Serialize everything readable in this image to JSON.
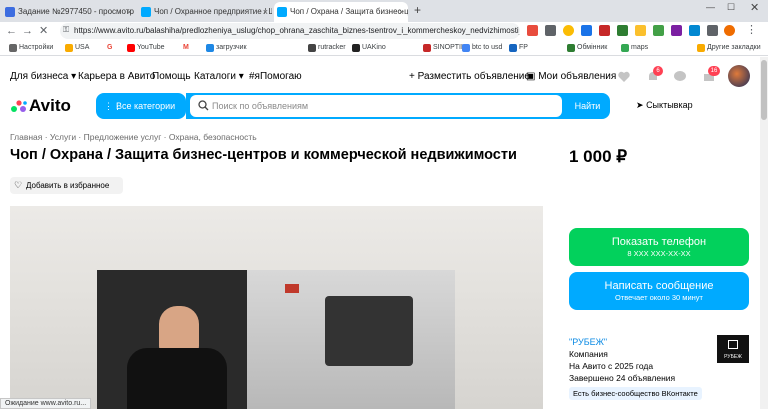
{
  "browser": {
    "tabs": [
      {
        "label": "Задание №2977450 - просмотр з",
        "favicon": "sp-icon",
        "color": "#3d6de0"
      },
      {
        "label": "Чоп / Охранное предприятие / Ш",
        "favicon": "avito-icon",
        "color": "#00aaff"
      },
      {
        "label": "Чоп / Охрана / Защита бизнес-ц",
        "favicon": "avito-icon",
        "color": "#00aaff"
      }
    ],
    "url": "https://www.avito.ru/balashiha/predlozheniya_uslug/chop_ohrana_zaschita_biznes-tsentrov_i_kommercheskoy_nedvizhimosti_...",
    "bookmarks": [
      "Настройки",
      "USA",
      "G",
      "YouTube",
      "M",
      "загрузчик",
      "rutracker",
      "UAKino",
      "SINOPTIK",
      "btc to usd",
      "FP",
      "Обмінник",
      "maps",
      "Другие закладки"
    ],
    "status": "Ожидание www.avito.ru..."
  },
  "header": {
    "links": [
      "Для бизнеса",
      "Карьера в Авито",
      "Помощь",
      "Каталоги",
      "#яПомогаю"
    ],
    "post_ad": "Разместить объявление",
    "my_ads": "Мои объявления",
    "notif_count": "6",
    "cart_count": "16"
  },
  "search": {
    "logo": "Avito",
    "categories_label": "Все категории",
    "placeholder": "Поиск по объявлениям",
    "button": "Найти",
    "location": "Сыктывкар"
  },
  "listing": {
    "breadcrumb": [
      "Главная",
      "Услуги",
      "Предложение услуг",
      "Охрана, безопасность"
    ],
    "title": "Чоп / Охрана / Защита бизнес-центров и коммерческой недвижимости",
    "price": "1 000 ₽",
    "favorite_label": "Добавить в избранное"
  },
  "actions": {
    "phone_main": "Показать телефон",
    "phone_sub": "8 XXX XXX-XX-XX",
    "msg_main": "Написать сообщение",
    "msg_sub": "Отвечает около 30 минут"
  },
  "seller": {
    "name": "\"РУБЕЖ\"",
    "type": "Компания",
    "since": "На Авито с 2025 года",
    "completed": "Завершено 24 объявления",
    "vk_badge": "Есть бизнес-сообщество ВКонтакте",
    "logo_text": "РУБЕЖ"
  },
  "colors": {
    "accent": "#00aaff",
    "phone": "#02d15c",
    "link": "#0a8ae4"
  }
}
